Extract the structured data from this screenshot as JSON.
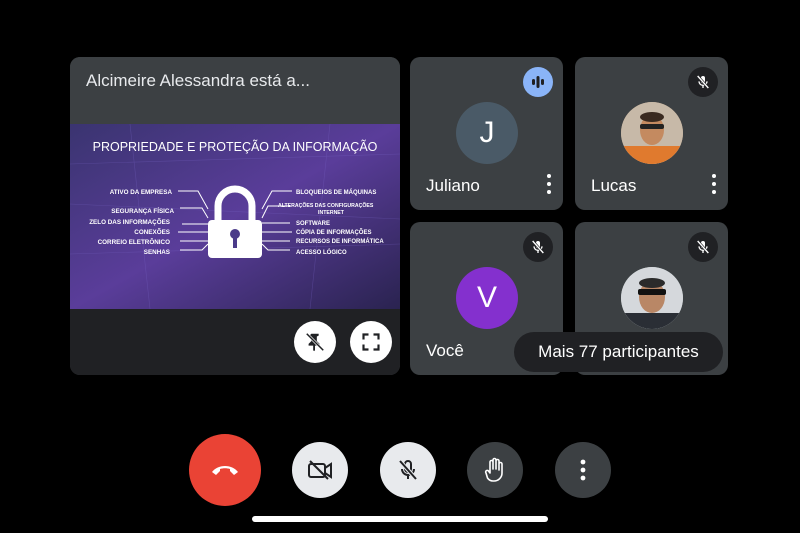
{
  "presentation": {
    "title": "Alcimeire Alessandra está a...",
    "slide": {
      "heading": "PROPRIEDADE E PROTEÇÃO DA INFORMAÇÃO",
      "left_items": [
        "ATIVO DA EMPRESA",
        "SEGURANÇA FÍSICA",
        "ZELO DAS INFORMAÇÕES",
        "CONEXÕES",
        "CORREIO ELETRÔNICO",
        "SENHAS"
      ],
      "right_items": [
        "BLOQUEIOS DE MÁQUINAS",
        "ALTERAÇÕES DAS CONFIGURAÇÕES",
        "INTERNET",
        "SOFTWARE",
        "CÓPIA DE INFORMAÇÕES",
        "RECURSOS DE INFORMÁTICA",
        "ACESSO LÓGICO"
      ]
    },
    "unpin_icon": "pin-off-icon",
    "fullscreen_icon": "fullscreen-icon"
  },
  "participants": [
    {
      "name": "Juliano",
      "initial": "J",
      "avatar_color": "#4a5a67",
      "status": "speaking"
    },
    {
      "name": "Lucas",
      "avatar_type": "photo",
      "status": "muted"
    },
    {
      "name": "Você",
      "initial": "V",
      "avatar_color": "#8430ce",
      "status": "muted"
    },
    {
      "name": "",
      "avatar_type": "photo",
      "status": "muted"
    }
  ],
  "more_participants": "Mais 77 participantes",
  "controls": {
    "end_call_icon": "hangup-icon",
    "camera_icon": "camera-off-icon",
    "mic_icon": "mic-off-icon",
    "hand_icon": "raise-hand-icon",
    "more_icon": "more-vert-icon",
    "end_call_color": "#ea4335"
  }
}
